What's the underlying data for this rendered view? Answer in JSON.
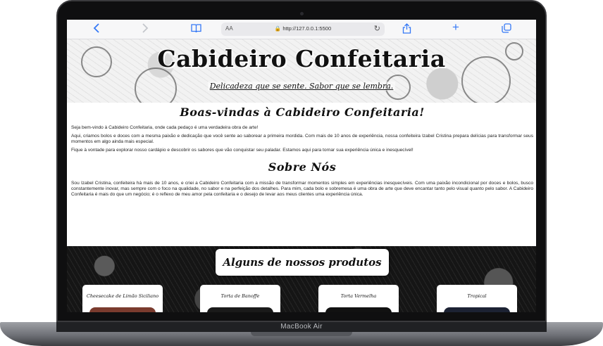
{
  "device": {
    "brand_label": "MacBook Air"
  },
  "browser": {
    "back_icon": "chevron-left-icon",
    "forward_icon": "chevron-right-icon",
    "bookmarks_icon": "book-icon",
    "reader_label": "AA",
    "lock_icon": "lock-icon",
    "url": "http://127.0.0.1:5500",
    "reload_icon": "reload-icon",
    "share_icon": "share-icon",
    "new_tab_icon": "plus-icon",
    "tabs_icon": "tabs-icon"
  },
  "hero": {
    "title": "Cabideiro Confeitaria",
    "subtitle": "Delicadeza que se sente. Sabor que se lembra."
  },
  "welcome": {
    "heading": "Boas-vindas à Cabideiro Confeitaria!",
    "paragraphs": [
      "Seja bem-vindo à Cabideiro Confeitaria, onde cada pedaço é uma verdadeira obra de arte!",
      "Aqui, criamos bolos e doces com a mesma paixão e dedicação que você sente ao saborear a primeira mordida. Com mais de 10 anos de experiência, nossa confeiteira Izabel Cristina prepara delícias para transformar seus momentos em algo ainda mais especial.",
      "Fique à vontade para explorar nosso cardápio e descobrir os sabores que vão conquistar seu paladar. Estamos aqui para tornar sua experiência única e inesquecível!"
    ]
  },
  "about": {
    "heading": "Sobre Nós",
    "paragraph": "Sou Izabel Cristina, confeiteira há mais de 10 anos, e criei a Cabideiro Confeitaria com a missão de transformar momentos simples em experiências inesquecíveis. Com uma paixão incondicional por doces e bolos, busco constantemente inovar, mas sempre com o foco na qualidade, no sabor e na perfeição dos detalhes. Para mim, cada bolo e sobremesa é uma obra de arte que deve encantar tanto pelo visual quanto pelo sabor. A Cabideiro Confeitaria é mais do que um negócio; é o reflexo de meu amor pela confeitaria e o desejo de levar aos meus clientes uma experiência única."
  },
  "products": {
    "heading": "Alguns de nossos produtos",
    "items": [
      {
        "name": "Cheesecake de Limão Siciliano",
        "img_color": "#7a3b2e"
      },
      {
        "name": "Torta de Banoffe",
        "img_color": "#1a1a1a"
      },
      {
        "name": "Torta Vermelha",
        "img_color": "#111111"
      },
      {
        "name": "Tropical",
        "img_color": "#1c2233"
      }
    ]
  },
  "colors": {
    "accent_blue": "#3478f6",
    "bezel": "#0f0f10"
  }
}
